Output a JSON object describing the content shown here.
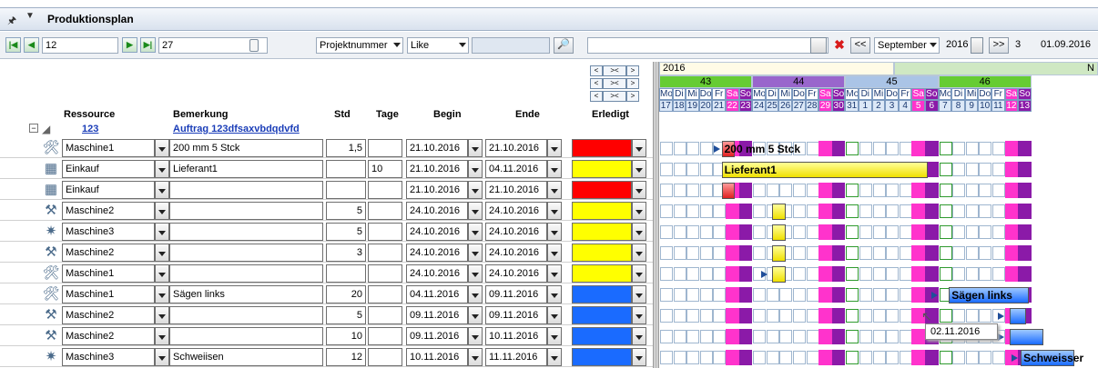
{
  "panel_title": "Produktionsplan",
  "toolbar": {
    "from_value": "12",
    "to_value": "27",
    "filter_field": "Projektnummer",
    "filter_op": "Like",
    "filter_text": "",
    "month": "September",
    "year": "2016",
    "step": "3",
    "date": "01.09.2016",
    "prev_label": "<<",
    "next_label": ">>"
  },
  "columns": {
    "ressource": "Ressource",
    "bemerkung": "Bemerkung",
    "std": "Std",
    "tage": "Tage",
    "begin": "Begin",
    "ende": "Ende",
    "erledigt": "Erledigt"
  },
  "order": {
    "number": "123",
    "title": "Auftrag 123dfsaxvbdqdvfd"
  },
  "rows": [
    {
      "icon": "machine-icon",
      "ressource": "Maschine1",
      "bemerkung": "200 mm 5 Stck",
      "std": "1,5",
      "tage": "",
      "begin": "21.10.2016",
      "ende": "21.10.2016",
      "color": "#ff0000"
    },
    {
      "icon": "purchase-icon",
      "ressource": "Einkauf",
      "bemerkung": "Lieferant1",
      "std": "",
      "tage": "10",
      "begin": "21.10.2016",
      "ende": "04.11.2016",
      "color": "#ffff00"
    },
    {
      "icon": "purchase-icon",
      "ressource": "Einkauf",
      "bemerkung": "",
      "std": "",
      "tage": "",
      "begin": "21.10.2016",
      "ende": "21.10.2016",
      "color": "#ff0000"
    },
    {
      "icon": "tool-icon",
      "ressource": "Maschine2",
      "bemerkung": "",
      "std": "5",
      "tage": "",
      "begin": "24.10.2016",
      "ende": "24.10.2016",
      "color": "#ffff00"
    },
    {
      "icon": "weld-icon",
      "ressource": "Maschine3",
      "bemerkung": "",
      "std": "5",
      "tage": "",
      "begin": "24.10.2016",
      "ende": "24.10.2016",
      "color": "#ffff00"
    },
    {
      "icon": "tool-icon",
      "ressource": "Maschine2",
      "bemerkung": "",
      "std": "3",
      "tage": "",
      "begin": "24.10.2016",
      "ende": "24.10.2016",
      "color": "#ffff00"
    },
    {
      "icon": "machine-icon",
      "ressource": "Maschine1",
      "bemerkung": "",
      "std": "",
      "tage": "",
      "begin": "24.10.2016",
      "ende": "24.10.2016",
      "color": "#ffff00"
    },
    {
      "icon": "machine-icon",
      "ressource": "Maschine1",
      "bemerkung": "Sägen links",
      "std": "20",
      "tage": "",
      "begin": "04.11.2016",
      "ende": "09.11.2016",
      "color": "#1a6bff"
    },
    {
      "icon": "tool-icon",
      "ressource": "Maschine2",
      "bemerkung": "",
      "std": "5",
      "tage": "",
      "begin": "09.11.2016",
      "ende": "09.11.2016",
      "color": "#1a6bff"
    },
    {
      "icon": "tool-icon",
      "ressource": "Maschine2",
      "bemerkung": "",
      "std": "10",
      "tage": "",
      "begin": "09.11.2016",
      "ende": "10.11.2016",
      "color": "#1a6bff"
    },
    {
      "icon": "weld-icon",
      "ressource": "Maschine3",
      "bemerkung": "Schweiisen",
      "std": "12",
      "tage": "",
      "begin": "10.11.2016",
      "ende": "11.11.2016",
      "color": "#1a6bff"
    }
  ],
  "gantt": {
    "year": "2016",
    "year_next": "N",
    "weeks": [
      "43",
      "44",
      "45",
      "46"
    ],
    "day_names": [
      "Mo",
      "Di",
      "Mi",
      "Do",
      "Fr",
      "Sa",
      "So",
      "Mo",
      "Di",
      "Mi",
      "Do",
      "Fr",
      "Sa",
      "So",
      "Mo",
      "Di",
      "Mi",
      "Do",
      "Fr",
      "Sa",
      "So",
      "Mo",
      "Di",
      "Mi",
      "Do",
      "Fr",
      "Sa",
      "So"
    ],
    "day_nums": [
      "17",
      "18",
      "19",
      "20",
      "21",
      "22",
      "23",
      "24",
      "25",
      "26",
      "27",
      "28",
      "29",
      "30",
      "31",
      "1",
      "2",
      "3",
      "4",
      "5",
      "6",
      "7",
      "8",
      "9",
      "10",
      "11",
      "12",
      "13"
    ],
    "bar_labels": {
      "b1": "200 mm 5 Stck",
      "b2": "Lieferant1",
      "b8": "Sägen links",
      "b11": "Schweisser"
    },
    "tooltip": "02.11.2016",
    "colors": {
      "weekend": "#ff33cc",
      "weekend_dark": "#8b1aa8",
      "week_green": "#66cc33",
      "week_purple": "#9966cc",
      "week_blue": "#aac4e6"
    }
  }
}
